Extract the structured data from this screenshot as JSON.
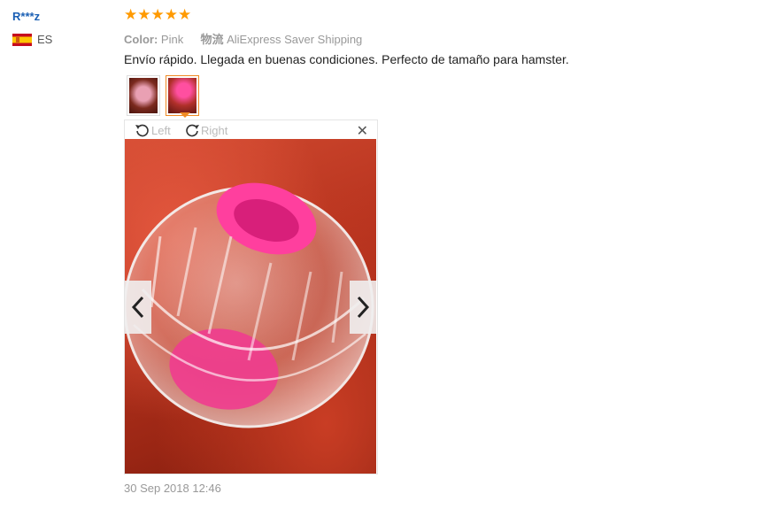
{
  "reviewer": {
    "name": "R***z",
    "country_code": "ES",
    "flag_icon": "flag-spain-icon"
  },
  "rating": {
    "stars": 5,
    "max": 5,
    "star_color": "#ff9a00"
  },
  "order_info": {
    "color_label": "Color:",
    "color_value": "Pink",
    "shipping_label": "物流",
    "shipping_value": "AliExpress Saver Shipping"
  },
  "review": {
    "text": "Envío rápido. Llegada en buenas condiciones. Perfecto de tamaño para hamster."
  },
  "photos": {
    "thumbnails": [
      {
        "name": "review-photo-thumbnail-1",
        "selected": false
      },
      {
        "name": "review-photo-thumbnail-2",
        "selected": true
      }
    ],
    "viewer": {
      "rotate_left_label": "Left",
      "rotate_right_label": "Right",
      "close_icon": "close-icon",
      "prev_icon": "chevron-left-icon",
      "next_icon": "chevron-right-icon"
    }
  },
  "timestamp": "30 Sep 2018 12:46",
  "colors": {
    "accent": "#f08b25",
    "link": "#1a5fb4",
    "muted": "#999999"
  }
}
